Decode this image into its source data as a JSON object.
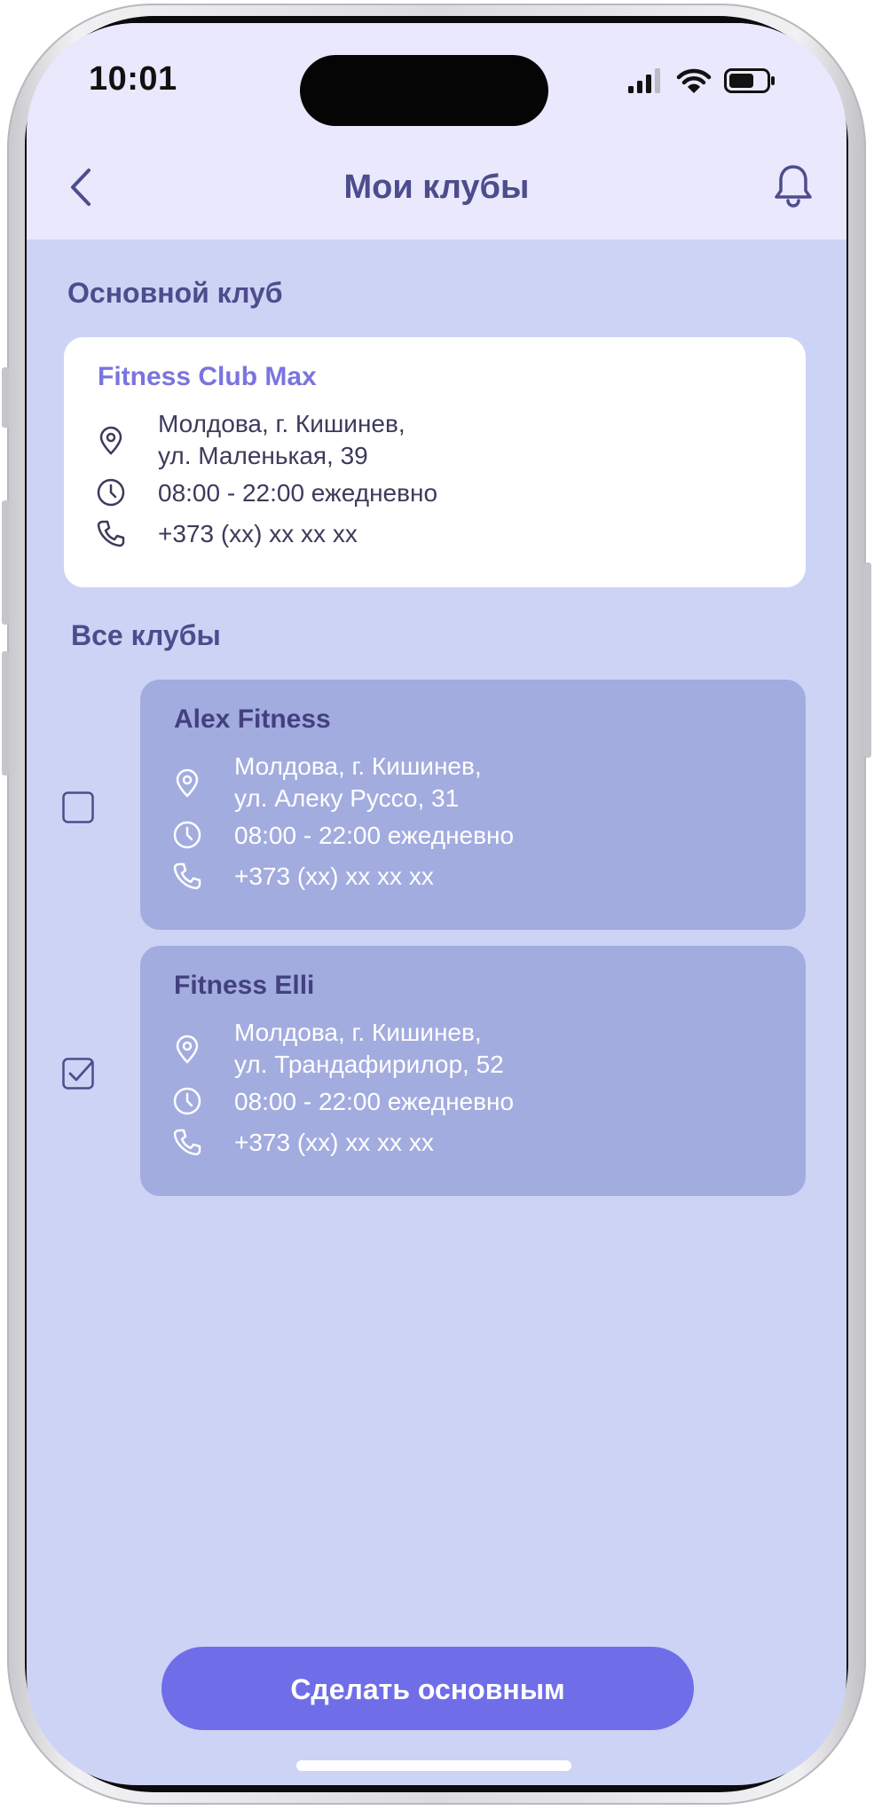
{
  "status_bar": {
    "time": "10:01"
  },
  "header": {
    "title": "Мои клубы"
  },
  "main_club": {
    "section_title": "Основной клуб",
    "name": "Fitness Club Max",
    "address_line1": "Молдова, г. Кишинев,",
    "address_line2": "ул. Маленькая, 39",
    "hours": "08:00 - 22:00 ежедневно",
    "phone": "+373 (xx) xx xx xx"
  },
  "all_clubs": {
    "section_title": "Все клубы",
    "items": [
      {
        "name": "Alex Fitness",
        "address_line1": "Молдова, г. Кишинев,",
        "address_line2": "ул. Алеку Руссо, 31",
        "hours": "08:00 - 22:00 ежедневно",
        "phone": "+373 (xx) xx xx xx",
        "checked": false
      },
      {
        "name": "Fitness Elli",
        "address_line1": "Молдова, г. Кишинев,",
        "address_line2": "ул. Трандафирилор, 52",
        "hours": "08:00 - 22:00 ежедневно",
        "phone": "+373 (xx) xx xx xx",
        "checked": true
      }
    ]
  },
  "action_button": {
    "label": "Сделать основным"
  },
  "colors": {
    "accent": "#6f6ee8",
    "title": "#4d4c8c",
    "header_bg": "#e9e8fc",
    "content_bg": "#cdd3f5",
    "club_card_bg": "#a3acdf"
  },
  "icons": [
    "back-icon",
    "bell-icon",
    "location-pin-icon",
    "clock-icon",
    "phone-icon",
    "checkbox-icon"
  ]
}
